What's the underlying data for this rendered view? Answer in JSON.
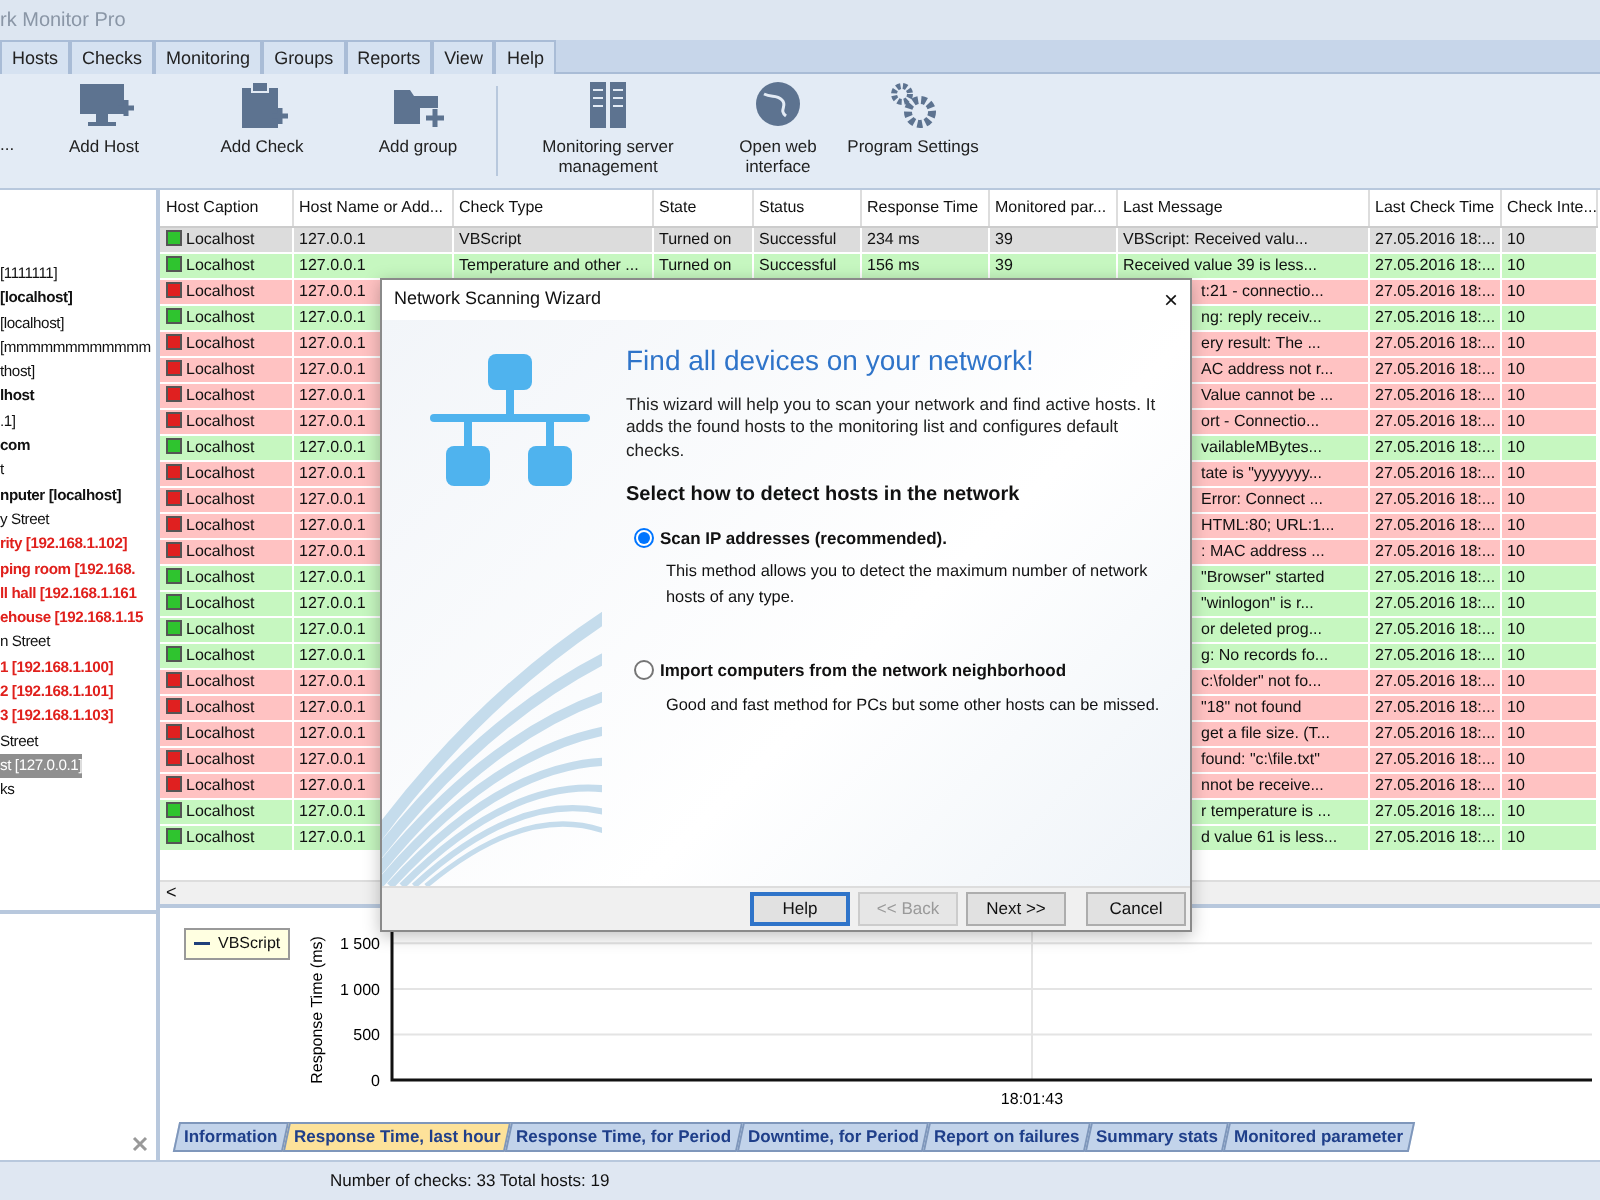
{
  "window": {
    "title": "rk Monitor Pro"
  },
  "menu": [
    {
      "label": "Hosts"
    },
    {
      "label": "Checks"
    },
    {
      "label": "Monitoring"
    },
    {
      "label": "Groups"
    },
    {
      "label": "Reports"
    },
    {
      "label": "View"
    },
    {
      "label": "Help"
    }
  ],
  "ribbon": {
    "cut_label": "...",
    "groups": [
      [
        {
          "label": "Add Host",
          "kind": "host"
        },
        {
          "label": "Add Check",
          "kind": "check"
        },
        {
          "label": "Add group",
          "kind": "group"
        }
      ],
      [
        {
          "label": "Monitoring server management",
          "kind": "server"
        },
        {
          "label": "Open web interface",
          "kind": "web"
        },
        {
          "label": "Program Settings",
          "kind": "settings"
        }
      ]
    ]
  },
  "sidebar": {
    "items": [
      {
        "label": "[1111111]",
        "kind": "plain",
        "selected": false
      },
      {
        "label": "[localhost]",
        "kind": "bold",
        "selected": false
      },
      {
        "label": "[localhost]",
        "kind": "plain",
        "selected": false
      },
      {
        "label": "[mmmmmmmmmmmm",
        "kind": "plain",
        "selected": false
      },
      {
        "label": "thost]",
        "kind": "plain",
        "selected": false
      },
      {
        "label": "lhost",
        "kind": "bold",
        "selected": false
      },
      {
        "label": ".1]",
        "kind": "plain",
        "selected": false
      },
      {
        "label": "com",
        "kind": "bold",
        "selected": false
      },
      {
        "label": "t",
        "kind": "plain",
        "selected": false
      },
      {
        "label": "nputer [localhost]",
        "kind": "bold",
        "selected": false
      },
      {
        "label": "y Street",
        "kind": "plain",
        "selected": false
      },
      {
        "label": "rity [192.168.1.102]",
        "kind": "alert",
        "selected": false
      },
      {
        "label": "ping room [192.168.",
        "kind": "alert",
        "selected": false
      },
      {
        "label": "ll hall [192.168.1.161",
        "kind": "alert",
        "selected": false
      },
      {
        "label": "ehouse [192.168.1.15",
        "kind": "alert",
        "selected": false
      },
      {
        "label": "n Street",
        "kind": "plain",
        "selected": false
      },
      {
        "label": "1 [192.168.1.100]",
        "kind": "alert",
        "selected": false
      },
      {
        "label": "2 [192.168.1.101]",
        "kind": "alert",
        "selected": false
      },
      {
        "label": "3 [192.168.1.103]",
        "kind": "alert",
        "selected": false
      },
      {
        "label": "Street",
        "kind": "plain",
        "selected": false
      },
      {
        "label": "st [127.0.0.1]",
        "kind": "plain",
        "selected": true
      },
      {
        "label": "ks",
        "kind": "plain",
        "selected": false
      }
    ]
  },
  "table": {
    "columns": [
      "Host Caption",
      "Host Name or Add...",
      "Check Type",
      "State",
      "Status",
      "Response Time",
      "Monitored par...",
      "Last Message",
      "Last Check Time",
      "Check Inte..."
    ],
    "rows": [
      {
        "failed": false,
        "selected": true,
        "cells": [
          "Localhost",
          "127.0.0.1",
          "VBScript",
          "Turned on",
          "Successful",
          "234 ms",
          "39",
          "VBScript: Received valu...",
          "27.05.2016 18:...",
          "10"
        ]
      },
      {
        "failed": false,
        "selected": false,
        "cells": [
          "Localhost",
          "127.0.0.1",
          "Temperature and other ...",
          "Turned on",
          "Successful",
          "156 ms",
          "39",
          "Received value 39 is less...",
          "27.05.2016 18:...",
          "10"
        ]
      },
      {
        "failed": true,
        "selected": false,
        "cells": [
          "Localhost",
          "127.0.0.1",
          null,
          null,
          null,
          null,
          null,
          "t:21 - connectio...",
          "27.05.2016 18:...",
          "10"
        ]
      },
      {
        "failed": false,
        "selected": false,
        "cells": [
          "Localhost",
          "127.0.0.1",
          null,
          null,
          null,
          null,
          null,
          "ng: reply receiv...",
          "27.05.2016 18:...",
          "10"
        ]
      },
      {
        "failed": true,
        "selected": false,
        "cells": [
          "Localhost",
          "127.0.0.1",
          null,
          null,
          null,
          null,
          null,
          "ery result:  The ...",
          "27.05.2016 18:...",
          "10"
        ]
      },
      {
        "failed": true,
        "selected": false,
        "cells": [
          "Localhost",
          "127.0.0.1",
          null,
          null,
          null,
          null,
          null,
          "AC address not r...",
          "27.05.2016 18:...",
          "10"
        ]
      },
      {
        "failed": true,
        "selected": false,
        "cells": [
          "Localhost",
          "127.0.0.1",
          null,
          null,
          null,
          null,
          null,
          "Value cannot be ...",
          "27.05.2016 18:...",
          "10"
        ]
      },
      {
        "failed": true,
        "selected": false,
        "cells": [
          "Localhost",
          "127.0.0.1",
          null,
          null,
          null,
          null,
          null,
          "ort - Connectio...",
          "27.05.2016 18:...",
          "10"
        ]
      },
      {
        "failed": false,
        "selected": false,
        "cells": [
          "Localhost",
          "127.0.0.1",
          null,
          null,
          null,
          null,
          null,
          "vailableMBytes...",
          "27.05.2016 18:...",
          "10"
        ]
      },
      {
        "failed": true,
        "selected": false,
        "cells": [
          "Localhost",
          "127.0.0.1",
          null,
          null,
          null,
          null,
          null,
          "tate is \"yyyyyyy...",
          "27.05.2016 18:...",
          "10"
        ]
      },
      {
        "failed": true,
        "selected": false,
        "cells": [
          "Localhost",
          "127.0.0.1",
          null,
          null,
          null,
          null,
          null,
          "Error: Connect ...",
          "27.05.2016 18:...",
          "10"
        ]
      },
      {
        "failed": true,
        "selected": false,
        "cells": [
          "Localhost",
          "127.0.0.1",
          null,
          null,
          null,
          null,
          null,
          "HTML:80; URL:1...",
          "27.05.2016 18:...",
          "10"
        ]
      },
      {
        "failed": true,
        "selected": false,
        "cells": [
          "Localhost",
          "127.0.0.1",
          null,
          null,
          null,
          null,
          null,
          ": MAC address ...",
          "27.05.2016 18:...",
          "10"
        ]
      },
      {
        "failed": false,
        "selected": false,
        "cells": [
          "Localhost",
          "127.0.0.1",
          null,
          null,
          null,
          null,
          null,
          "\"Browser\" started",
          "27.05.2016 18:...",
          "10"
        ]
      },
      {
        "failed": false,
        "selected": false,
        "cells": [
          "Localhost",
          "127.0.0.1",
          null,
          null,
          null,
          null,
          null,
          "\"winlogon\" is r...",
          "27.05.2016 18:...",
          "10"
        ]
      },
      {
        "failed": false,
        "selected": false,
        "cells": [
          "Localhost",
          "127.0.0.1",
          null,
          null,
          null,
          null,
          null,
          "or deleted prog...",
          "27.05.2016 18:...",
          "10"
        ]
      },
      {
        "failed": false,
        "selected": false,
        "cells": [
          "Localhost",
          "127.0.0.1",
          null,
          null,
          null,
          null,
          null,
          "g: No records fo...",
          "27.05.2016 18:...",
          "10"
        ]
      },
      {
        "failed": true,
        "selected": false,
        "cells": [
          "Localhost",
          "127.0.0.1",
          null,
          null,
          null,
          null,
          null,
          "c:\\folder\" not fo...",
          "27.05.2016 18:...",
          "10"
        ]
      },
      {
        "failed": true,
        "selected": false,
        "cells": [
          "Localhost",
          "127.0.0.1",
          null,
          null,
          null,
          null,
          null,
          "\"18\" not found",
          "27.05.2016 18:...",
          "10"
        ]
      },
      {
        "failed": true,
        "selected": false,
        "cells": [
          "Localhost",
          "127.0.0.1",
          null,
          null,
          null,
          null,
          null,
          "get a file size. (T...",
          "27.05.2016 18:...",
          "10"
        ]
      },
      {
        "failed": true,
        "selected": false,
        "cells": [
          "Localhost",
          "127.0.0.1",
          null,
          null,
          null,
          null,
          null,
          "found: \"c:\\file.txt\"",
          "27.05.2016 18:...",
          "10"
        ]
      },
      {
        "failed": true,
        "selected": false,
        "cells": [
          "Localhost",
          "127.0.0.1",
          null,
          null,
          null,
          null,
          null,
          "nnot be receive...",
          "27.05.2016 18:...",
          "10"
        ]
      },
      {
        "failed": false,
        "selected": false,
        "cells": [
          "Localhost",
          "127.0.0.1",
          null,
          null,
          null,
          null,
          null,
          "r temperature is ...",
          "27.05.2016 18:...",
          "10"
        ]
      },
      {
        "failed": false,
        "selected": false,
        "cells": [
          "Localhost",
          "127.0.0.1",
          null,
          null,
          null,
          null,
          null,
          "d value 61 is less...",
          "27.05.2016 18:...",
          "10"
        ]
      }
    ],
    "scroll_arrow": "<"
  },
  "dialog": {
    "title": "Network Scanning Wizard",
    "close": "×",
    "heading": "Find all devices on your network!",
    "intro": "This wizard will help you to scan your network and find active hosts. It adds the found hosts to the monitoring list and configures default checks.",
    "subheading": "Select how to detect hosts in the network",
    "options": [
      {
        "label": "Scan IP addresses (recommended).",
        "description": "This method allows you to detect the maximum number of network hosts of any type.",
        "selected": true
      },
      {
        "label": "Import computers from the network neighborhood",
        "description": "Good and fast method for PCs but some other hosts can be missed.",
        "selected": false
      }
    ],
    "buttons": [
      {
        "label": "Help",
        "disabled": false,
        "focused": true
      },
      {
        "label": "<< Back",
        "disabled": true,
        "focused": false
      },
      {
        "label": "Next >>",
        "disabled": false,
        "focused": false
      },
      {
        "label": "Cancel",
        "disabled": false,
        "focused": false
      }
    ]
  },
  "chart_panel": {
    "chart_data": {
      "type": "line",
      "ylabel": "Response Time (ms)",
      "categories": [
        "18:01:43"
      ],
      "ylim": [
        0,
        1800
      ],
      "grid": true,
      "yticks": [
        0,
        500,
        {
          "value": 1000,
          "label": "1 000"
        },
        {
          "value": 1500,
          "label": "1 500"
        }
      ],
      "series": [
        {
          "name": "VBScript",
          "color": "#1f3f7a",
          "values": [
            null
          ]
        }
      ]
    },
    "tabs": [
      {
        "label": "Information",
        "selected": false
      },
      {
        "label": "Response Time, last hour",
        "selected": true
      },
      {
        "label": "Response Time, for Period",
        "selected": false
      },
      {
        "label": "Downtime, for Period",
        "selected": false
      },
      {
        "label": "Report on failures",
        "selected": false
      },
      {
        "label": "Summary stats",
        "selected": false
      },
      {
        "label": "Monitored parameter",
        "selected": false
      }
    ]
  },
  "status_bar": "Number of checks: 33  Total hosts: 19"
}
